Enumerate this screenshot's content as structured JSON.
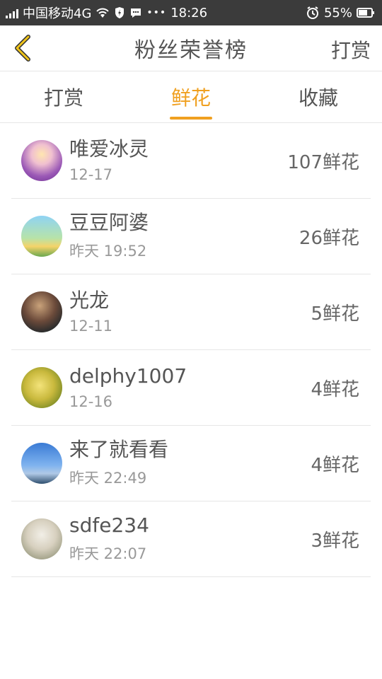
{
  "status_bar": {
    "carrier": "中国移动4G",
    "time": "18:26",
    "battery": "55%"
  },
  "header": {
    "title": "粉丝荣誉榜",
    "action_label": "打赏"
  },
  "tabs": [
    {
      "label": "打赏",
      "active": false
    },
    {
      "label": "鲜花",
      "active": true
    },
    {
      "label": "收藏",
      "active": false
    }
  ],
  "list": [
    {
      "name": "唯爱冰灵",
      "time": "12-17",
      "amount": "107鲜花"
    },
    {
      "name": "豆豆阿婆",
      "time": "昨天 19:52",
      "amount": "26鲜花"
    },
    {
      "name": "光龙",
      "time": "12-11",
      "amount": "5鲜花"
    },
    {
      "name": "delphy1007",
      "time": "12-16",
      "amount": "4鲜花"
    },
    {
      "name": "来了就看看",
      "time": "昨天 22:49",
      "amount": "4鲜花"
    },
    {
      "name": "sdfe234",
      "time": "昨天 22:07",
      "amount": "3鲜花"
    }
  ],
  "colors": {
    "accent": "#f0a020",
    "status_bar_bg": "#3b3b3b",
    "text_primary": "#555555",
    "text_secondary": "#999999",
    "divider": "#e6e6e6"
  },
  "icons": {
    "back": "chevron-left-icon",
    "signal": "signal-icon",
    "wifi": "wifi-icon",
    "shield": "shield-icon",
    "chat": "chat-bubble-icon",
    "more": "more-dots-icon",
    "alarm": "alarm-icon",
    "battery": "battery-icon"
  }
}
